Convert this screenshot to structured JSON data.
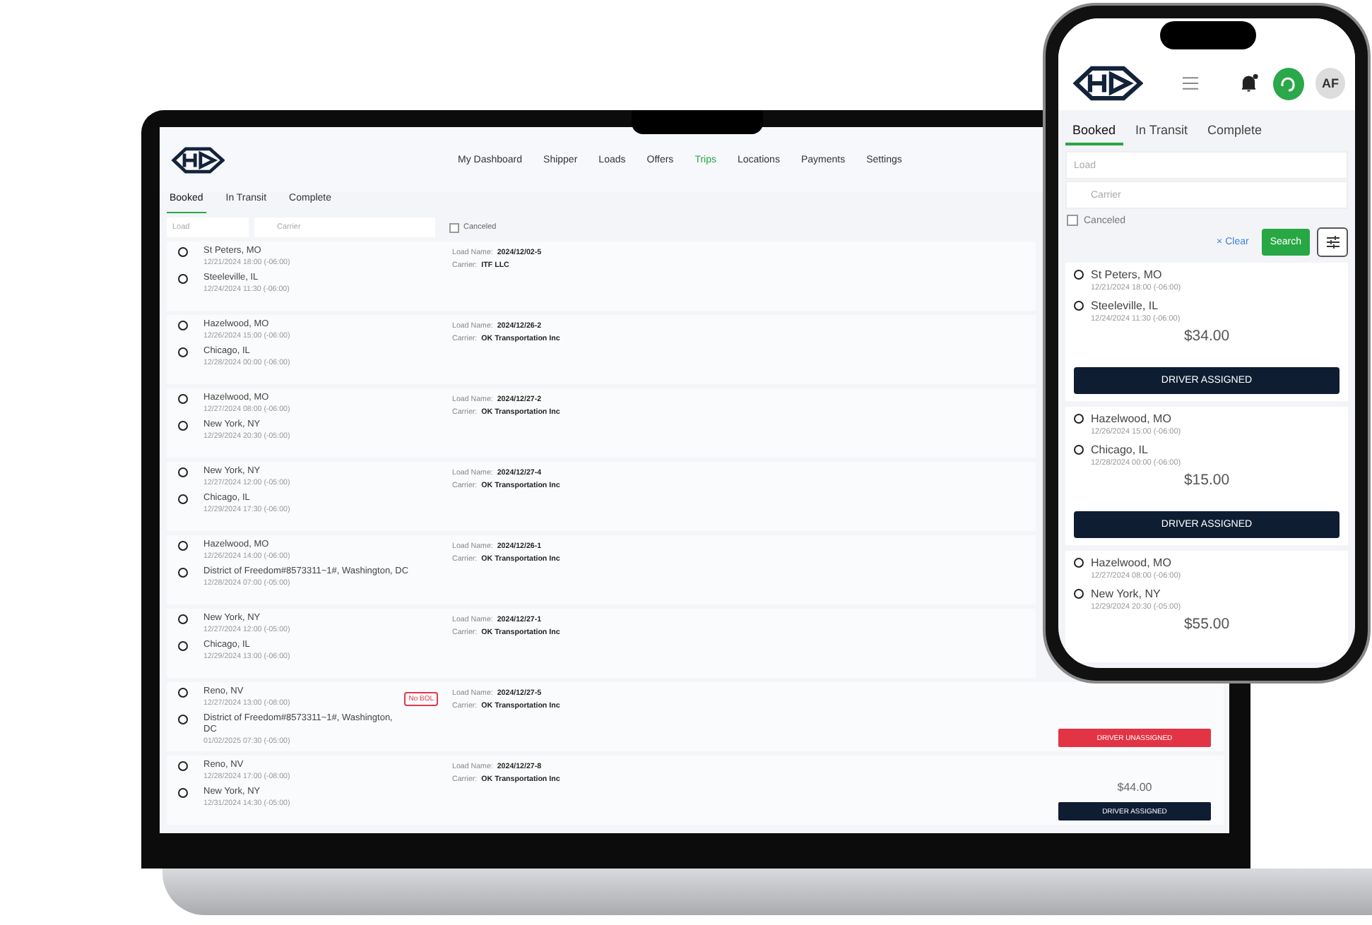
{
  "laptop": {
    "nav": [
      {
        "label": "My Dashboard",
        "selected": false
      },
      {
        "label": "Shipper",
        "selected": false
      },
      {
        "label": "Loads",
        "selected": false
      },
      {
        "label": "Offers",
        "selected": false
      },
      {
        "label": "Trips",
        "selected": true
      },
      {
        "label": "Locations",
        "selected": false
      },
      {
        "label": "Payments",
        "selected": false
      },
      {
        "label": "Settings",
        "selected": false
      }
    ],
    "tabs": [
      {
        "label": "Booked",
        "selected": true
      },
      {
        "label": "In Transit",
        "selected": false
      },
      {
        "label": "Complete",
        "selected": false
      }
    ],
    "filters": {
      "load_placeholder": "Load",
      "carrier_placeholder": "Carrier",
      "canceled": {
        "label": "Canceled",
        "checked": false
      }
    },
    "trips": [
      {
        "stops": [
          {
            "place": "St Peters, MO",
            "time": "12/21/2024 18:00 (-06:00)"
          },
          {
            "place": "Steeleville, IL",
            "time": "12/24/2024 11:30 (-06:00)"
          }
        ],
        "load_label": "Load Name:",
        "load_name": "2024/12/02-5",
        "carrier_label": "Carrier:",
        "carrier": "ITF LLC"
      },
      {
        "stops": [
          {
            "place": "Hazelwood, MO",
            "time": "12/26/2024 15:00 (-06:00)"
          },
          {
            "place": "Chicago, IL",
            "time": "12/28/2024 00:00 (-06:00)"
          }
        ],
        "load_label": "Load Name:",
        "load_name": "2024/12/26-2",
        "carrier_label": "Carrier:",
        "carrier": "OK Transportation Inc"
      },
      {
        "stops": [
          {
            "place": "Hazelwood, MO",
            "time": "12/27/2024 08:00 (-06:00)"
          },
          {
            "place": "New York, NY",
            "time": "12/29/2024 20:30 (-05:00)"
          }
        ],
        "load_label": "Load Name:",
        "load_name": "2024/12/27-2",
        "carrier_label": "Carrier:",
        "carrier": "OK Transportation Inc"
      },
      {
        "stops": [
          {
            "place": "New York, NY",
            "time": "12/27/2024 12:00 (-05:00)"
          },
          {
            "place": "Chicago, IL",
            "time": "12/29/2024 17:30 (-06:00)"
          }
        ],
        "load_label": "Load Name:",
        "load_name": "2024/12/27-4",
        "carrier_label": "Carrier:",
        "carrier": "OK Transportation Inc"
      },
      {
        "stops": [
          {
            "place": "Hazelwood, MO",
            "time": "12/26/2024 14:00 (-06:00)"
          },
          {
            "place": "District of Freedom#8573311~1#, Washington, DC",
            "time": "12/28/2024 07:00 (-05:00)"
          }
        ],
        "load_label": "Load Name:",
        "load_name": "2024/12/26-1",
        "carrier_label": "Carrier:",
        "carrier": "OK Transportation Inc"
      },
      {
        "stops": [
          {
            "place": "New York, NY",
            "time": "12/27/2024 12:00 (-05:00)"
          },
          {
            "place": "Chicago, IL",
            "time": "12/29/2024 13:00 (-06:00)"
          }
        ],
        "load_label": "Load Name:",
        "load_name": "2024/12/27-1",
        "carrier_label": "Carrier:",
        "carrier": "OK Transportation Inc"
      },
      {
        "stops": [
          {
            "place": "Reno, NV",
            "time": "12/27/2024 13:00 (-08:00)"
          },
          {
            "place": "District of Freedom#8573311~1#, Washington, DC",
            "time": "01/02/2025 07:30 (-05:00)"
          }
        ],
        "badge": "No BOL",
        "load_label": "Load Name:",
        "load_name": "2024/12/27-5",
        "carrier_label": "Carrier:",
        "carrier": "OK Transportation Inc",
        "status": {
          "label": "DRIVER UNASSIGNED",
          "kind": "unassigned"
        }
      },
      {
        "stops": [
          {
            "place": "Reno, NV",
            "time": "12/28/2024 17:00 (-08:00)"
          },
          {
            "place": "New York, NY",
            "time": "12/31/2024 14:30 (-05:00)"
          }
        ],
        "load_label": "Load Name:",
        "load_name": "2024/12/27-8",
        "carrier_label": "Carrier:",
        "carrier": "OK Transportation Inc",
        "price": "$44.00",
        "status": {
          "label": "DRIVER ASSIGNED",
          "kind": "assigned"
        }
      }
    ]
  },
  "phone": {
    "header": {
      "notification": true,
      "avatar": "AF"
    },
    "tabs": [
      {
        "label": "Booked",
        "selected": true
      },
      {
        "label": "In Transit",
        "selected": false
      },
      {
        "label": "Complete",
        "selected": false
      }
    ],
    "filters": {
      "load_placeholder": "Load",
      "carrier_placeholder": "Carrier",
      "canceled": {
        "label": "Canceled",
        "checked": false
      },
      "clear_icon": "×",
      "clear": "Clear",
      "search": "Search"
    },
    "trips": [
      {
        "stops": [
          {
            "place": "St Peters, MO",
            "time": "12/21/2024 18:00 (-06:00)"
          },
          {
            "place": "Steeleville, IL",
            "time": "12/24/2024 11:30 (-06:00)"
          }
        ],
        "price": "$34.00",
        "status": {
          "label": "DRIVER ASSIGNED",
          "kind": "assigned"
        }
      },
      {
        "stops": [
          {
            "place": "Hazelwood, MO",
            "time": "12/26/2024 15:00 (-06:00)"
          },
          {
            "place": "Chicago, IL",
            "time": "12/28/2024 00:00 (-06:00)"
          }
        ],
        "price": "$15.00",
        "status": {
          "label": "DRIVER ASSIGNED",
          "kind": "assigned"
        }
      },
      {
        "stops": [
          {
            "place": "Hazelwood, MO",
            "time": "12/27/2024 08:00 (-06:00)"
          },
          {
            "place": "New York, NY",
            "time": "12/29/2024 20:30 (-05:00)"
          }
        ],
        "price": "$55.00"
      }
    ]
  }
}
